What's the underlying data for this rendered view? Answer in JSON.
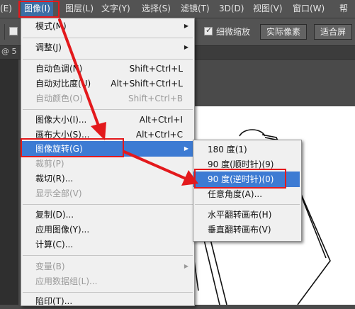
{
  "menubar": {
    "items": [
      "(E)",
      "图像(I)",
      "图层(L)",
      "文字(Y)",
      "选择(S)",
      "滤镜(T)",
      "3D(D)",
      "视图(V)",
      "窗口(W)",
      "帮"
    ]
  },
  "options": {
    "fine_zoom_label": "细微缩放",
    "actual_pixels_label": "实际像素",
    "fit_screen_label": "适合屏"
  },
  "tab": {
    "doc_label": "@ 5"
  },
  "image_menu": {
    "items": [
      {
        "label": "模式(M)",
        "shortcut": ""
      },
      {
        "label": "调整(J)",
        "shortcut": ""
      },
      {
        "label": "自动色调(N)",
        "shortcut": "Shift+Ctrl+L"
      },
      {
        "label": "自动对比度(U)",
        "shortcut": "Alt+Shift+Ctrl+L"
      },
      {
        "label": "自动颜色(O)",
        "shortcut": "Shift+Ctrl+B"
      },
      {
        "label": "图像大小(I)...",
        "shortcut": "Alt+Ctrl+I"
      },
      {
        "label": "画布大小(S)...",
        "shortcut": "Alt+Ctrl+C"
      },
      {
        "label": "图像旋转(G)",
        "shortcut": ""
      },
      {
        "label": "裁剪(P)",
        "shortcut": ""
      },
      {
        "label": "裁切(R)...",
        "shortcut": ""
      },
      {
        "label": "显示全部(V)",
        "shortcut": ""
      },
      {
        "label": "复制(D)...",
        "shortcut": ""
      },
      {
        "label": "应用图像(Y)...",
        "shortcut": ""
      },
      {
        "label": "计算(C)...",
        "shortcut": ""
      },
      {
        "label": "变量(B)",
        "shortcut": ""
      },
      {
        "label": "应用数据组(L)...",
        "shortcut": ""
      },
      {
        "label": "陷印(T)...",
        "shortcut": ""
      }
    ]
  },
  "rotation_menu": {
    "items": [
      {
        "label": "180 度(1)"
      },
      {
        "label": "90 度(顺时针)(9)"
      },
      {
        "label": "90 度(逆时针)(0)"
      },
      {
        "label": "任意角度(A)..."
      },
      {
        "label": "水平翻转画布(H)"
      },
      {
        "label": "垂直翻转画布(V)"
      }
    ]
  },
  "colors": {
    "highlight": "#3d7bd3",
    "annotation": "#e3191c"
  }
}
